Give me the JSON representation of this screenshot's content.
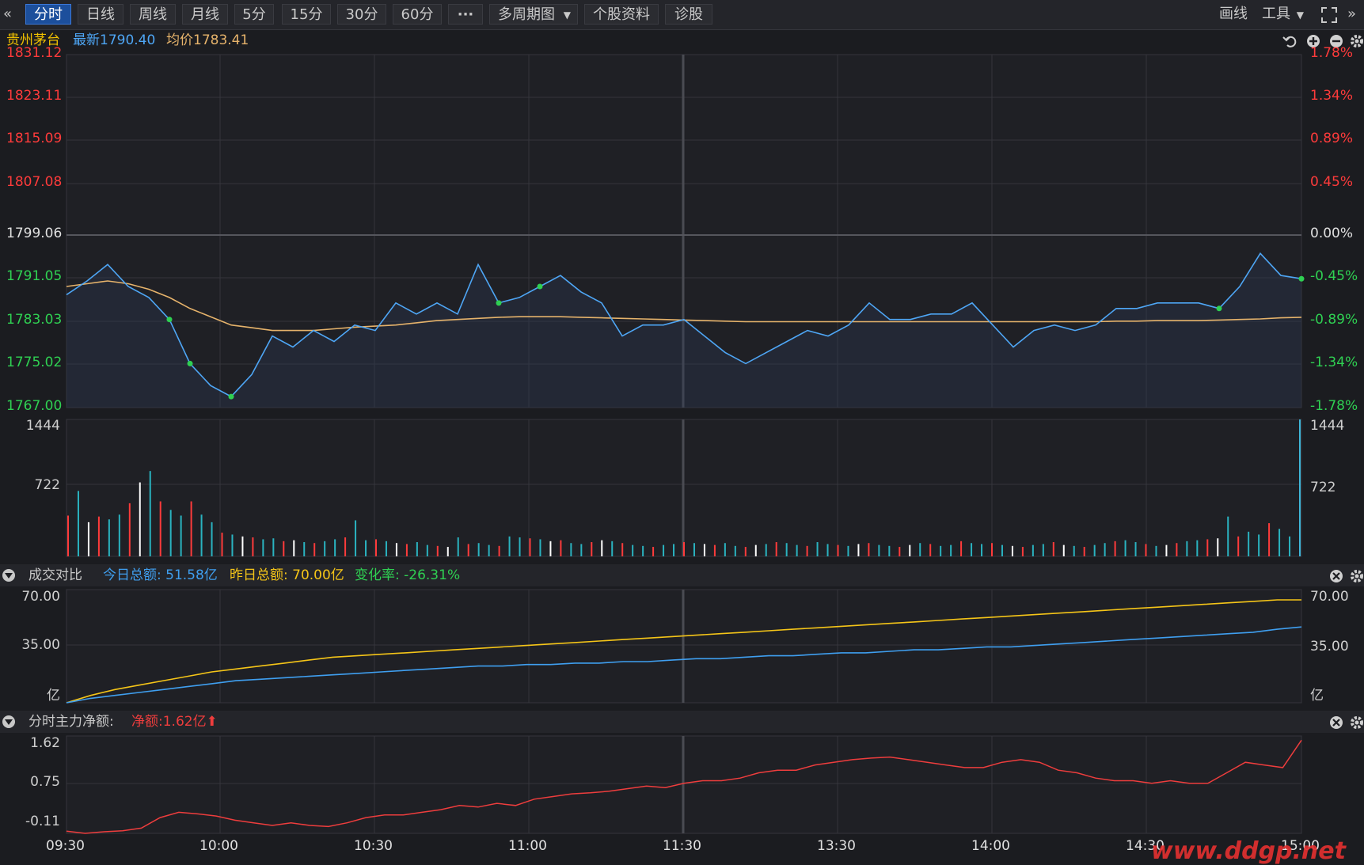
{
  "toolbar": {
    "collapse_icon": "«",
    "expand_icon": "»",
    "tabs": [
      "分时",
      "日线",
      "周线",
      "月线",
      "5分",
      "15分",
      "30分",
      "60分"
    ],
    "more": "···",
    "multi_period": "多周期图",
    "profile": "个股资料",
    "diagnose": "诊股",
    "draw": "画线",
    "tools": "工具"
  },
  "info": {
    "name": "贵州茅台",
    "latest_label": "最新",
    "latest": "1790.40",
    "avg_label": "均价",
    "avg": "1783.41"
  },
  "colors": {
    "up": "#ff3b3b",
    "down": "#2fd052",
    "price_line": "#4ea6f5",
    "avg_line": "#e6b36b",
    "today_amount": "#3f9ff0",
    "yesterday_amount": "#f5c518",
    "netflow": "#ee3d3d"
  },
  "price_axis": {
    "left": [
      "1831.12",
      "1823.11",
      "1815.09",
      "1807.08",
      "1799.06",
      "1791.05",
      "1783.03",
      "1775.02",
      "1767.00"
    ],
    "right": [
      "1.78%",
      "1.34%",
      "0.89%",
      "0.45%",
      "0.00%",
      "-0.45%",
      "-0.89%",
      "-1.34%",
      "-1.78%"
    ]
  },
  "volume_axis": {
    "left": [
      "1444",
      "722"
    ],
    "right": [
      "1444",
      "722"
    ]
  },
  "turnover_panel": {
    "title": "成交对比",
    "today_label": "今日总额: ",
    "today": "51.58亿",
    "yesterday_label": "昨日总额: ",
    "yesterday": "70.00亿",
    "change_label": "变化率: ",
    "change": "-26.31%",
    "axis_left": [
      "70.00",
      "35.00"
    ],
    "axis_right": [
      "70.00",
      "35.00"
    ],
    "unit": "亿"
  },
  "netflow_panel": {
    "title": "分时主力净额:",
    "net_label": "净额:",
    "net": "1.62亿",
    "arrow": "⬆",
    "axis": [
      "1.62",
      "0.75",
      "-0.11"
    ]
  },
  "time_axis": [
    "09:30",
    "10:00",
    "10:30",
    "11:00",
    "11:30",
    "13:30",
    "14:00",
    "14:30",
    "15:00"
  ],
  "watermark": "www.ddgp.net",
  "chart_data": [
    {
      "type": "line",
      "title": "贵州茅台",
      "x": [
        "09:30",
        "09:32",
        "09:34",
        "09:36",
        "09:38",
        "09:40",
        "09:42",
        "09:44",
        "09:46",
        "09:48",
        "09:50",
        "09:52",
        "09:54",
        "09:56",
        "09:58",
        "10:00",
        "10:05",
        "10:10",
        "10:15",
        "10:20",
        "10:25",
        "10:30",
        "10:35",
        "10:40",
        "10:45",
        "10:50",
        "10:55",
        "11:00",
        "11:05",
        "11:10",
        "11:15",
        "11:20",
        "11:25",
        "11:30",
        "13:05",
        "13:10",
        "13:15",
        "13:20",
        "13:25",
        "13:30",
        "13:35",
        "13:40",
        "13:45",
        "13:50",
        "13:55",
        "14:00",
        "14:05",
        "14:10",
        "14:15",
        "14:20",
        "14:25",
        "14:30",
        "14:35",
        "14:40",
        "14:45",
        "14:50",
        "14:55",
        "15:00"
      ],
      "series": [
        {
          "name": "最新",
          "values": [
            1787.5,
            1790,
            1793,
            1789,
            1787,
            1783,
            1775,
            1771,
            1769,
            1773,
            1780,
            1778,
            1781,
            1779,
            1782,
            1781,
            1786,
            1784,
            1786,
            1784,
            1793,
            1786,
            1787,
            1789,
            1791,
            1788,
            1786,
            1780,
            1782,
            1782,
            1783,
            1780,
            1777,
            1775,
            1777,
            1779,
            1781,
            1780,
            1782,
            1786,
            1783,
            1783,
            1784,
            1784,
            1786,
            1782,
            1778,
            1781,
            1782,
            1781,
            1782,
            1785,
            1785,
            1786,
            1786,
            1786,
            1785,
            1789,
            1795,
            1791,
            1790.4
          ]
        },
        {
          "name": "均价",
          "values": [
            1789,
            1789.5,
            1790,
            1789.5,
            1788.5,
            1787,
            1785,
            1783.5,
            1782,
            1781.5,
            1781,
            1781,
            1781,
            1781.3,
            1781.6,
            1781.8,
            1782,
            1782.4,
            1782.8,
            1783,
            1783.2,
            1783.4,
            1783.5,
            1783.5,
            1783.5,
            1783.4,
            1783.3,
            1783.2,
            1783.1,
            1783,
            1782.9,
            1782.8,
            1782.7,
            1782.6,
            1782.6,
            1782.6,
            1782.6,
            1782.6,
            1782.6,
            1782.6,
            1782.6,
            1782.6,
            1782.6,
            1782.6,
            1782.6,
            1782.6,
            1782.6,
            1782.6,
            1782.6,
            1782.6,
            1782.6,
            1782.7,
            1782.7,
            1782.8,
            1782.8,
            1782.8,
            1782.9,
            1783,
            1783.1,
            1783.3,
            1783.41
          ]
        }
      ],
      "ylim": [
        1767.0,
        1831.12
      ],
      "prev_close": 1799.06
    },
    {
      "type": "bar",
      "title": "volume",
      "ylim": [
        0,
        1444
      ],
      "values": [
        430,
        690,
        360,
        420,
        390,
        440,
        560,
        780,
        900,
        580,
        490,
        430,
        580,
        440,
        360,
        250,
        230,
        210,
        200,
        180,
        190,
        160,
        170,
        150,
        140,
        160,
        180,
        200,
        380,
        170,
        180,
        160,
        140,
        130,
        150,
        120,
        110,
        100,
        200,
        130,
        140,
        120,
        110,
        210,
        200,
        190,
        180,
        160,
        170,
        140,
        130,
        150,
        170,
        160,
        140,
        120,
        110,
        100,
        120,
        130,
        150,
        140,
        130,
        120,
        140,
        110,
        100,
        120,
        130,
        150,
        140,
        120,
        110,
        150,
        130,
        120,
        110,
        130,
        140,
        120,
        110,
        100,
        120,
        140,
        130,
        110,
        120,
        160,
        140,
        130,
        140,
        120,
        110,
        100,
        120,
        130,
        150,
        120,
        110,
        100,
        120,
        140,
        160,
        170,
        150,
        130,
        110,
        120,
        140,
        160,
        170,
        180,
        190,
        420,
        210,
        260,
        230,
        350,
        290,
        210,
        1444
      ]
    },
    {
      "type": "line",
      "title": "成交对比",
      "ylim": [
        0,
        77
      ],
      "series": [
        {
          "name": "昨日总额",
          "values": [
            0,
            5,
            9,
            12,
            15,
            18,
            21,
            23,
            25,
            27,
            29,
            31,
            32,
            33,
            34,
            35,
            36,
            37,
            38,
            39,
            40,
            41,
            42,
            43,
            44,
            45,
            46,
            47,
            48,
            49,
            50,
            51,
            52,
            53,
            54,
            55,
            56,
            57,
            58,
            59,
            60,
            61,
            62,
            63,
            64,
            65,
            66,
            67,
            68,
            69,
            70,
            70
          ]
        },
        {
          "name": "今日总额",
          "values": [
            0,
            3,
            5,
            7,
            9,
            11,
            13,
            15,
            16,
            17,
            18,
            19,
            20,
            21,
            22,
            23,
            24,
            25,
            25,
            26,
            26,
            27,
            27,
            28,
            28,
            29,
            30,
            30,
            31,
            32,
            32,
            33,
            34,
            34,
            35,
            36,
            36,
            37,
            38,
            38,
            39,
            40,
            41,
            42,
            43,
            44,
            45,
            46,
            47,
            48,
            50,
            51.58
          ]
        }
      ]
    },
    {
      "type": "line",
      "title": "分时主力净额",
      "ylim": [
        -0.15,
        1.7
      ],
      "series": [
        {
          "name": "净额",
          "values": [
            -0.11,
            -0.15,
            -0.12,
            -0.1,
            -0.05,
            0.15,
            0.25,
            0.22,
            0.18,
            0.1,
            0.05,
            0.0,
            0.05,
            0.0,
            -0.02,
            0.05,
            0.15,
            0.2,
            0.2,
            0.25,
            0.3,
            0.38,
            0.35,
            0.42,
            0.38,
            0.5,
            0.55,
            0.6,
            0.62,
            0.65,
            0.7,
            0.75,
            0.72,
            0.8,
            0.85,
            0.85,
            0.9,
            1.0,
            1.05,
            1.05,
            1.15,
            1.2,
            1.25,
            1.28,
            1.3,
            1.25,
            1.2,
            1.15,
            1.1,
            1.1,
            1.2,
            1.25,
            1.2,
            1.05,
            1.0,
            0.9,
            0.85,
            0.85,
            0.8,
            0.85,
            0.8,
            0.8,
            1.0,
            1.2,
            1.15,
            1.1,
            1.62
          ]
        }
      ]
    }
  ]
}
